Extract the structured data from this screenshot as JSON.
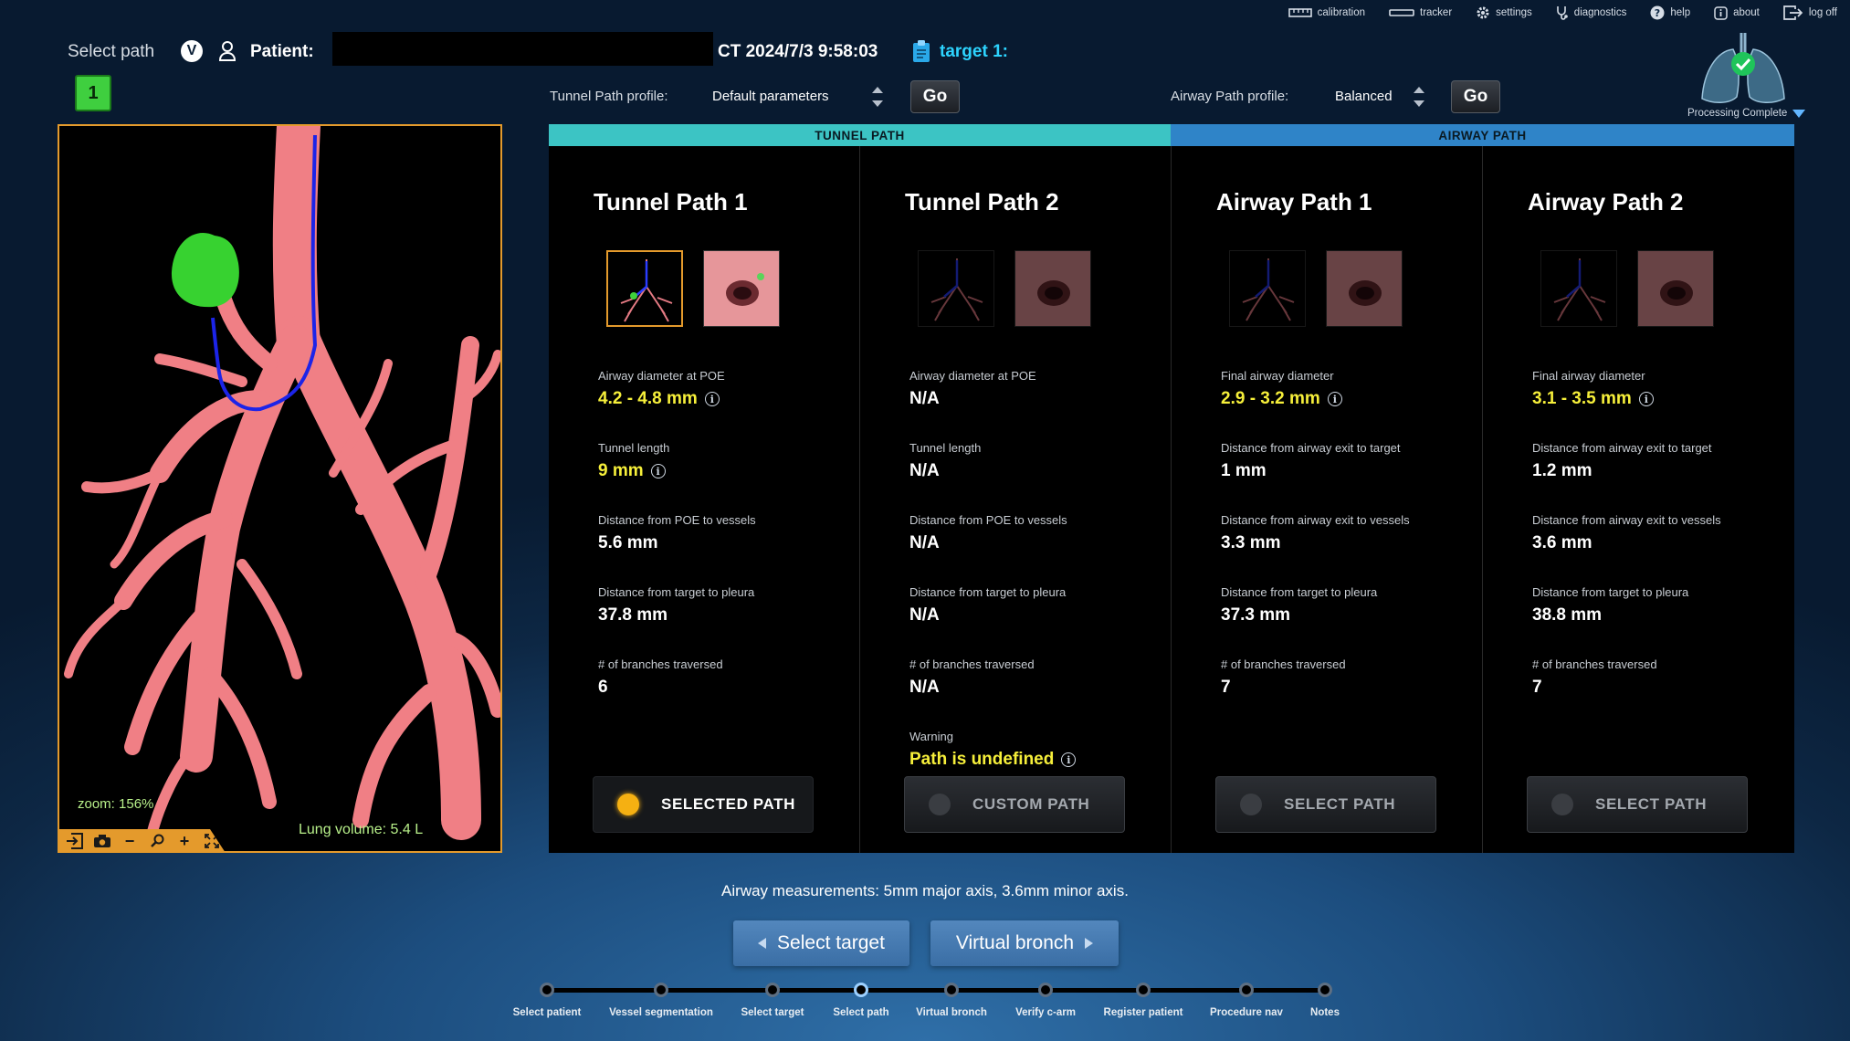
{
  "top_bar": {
    "items": [
      {
        "label": "calibration",
        "icon": "ruler-icon"
      },
      {
        "label": "tracker",
        "icon": "tracker-icon"
      },
      {
        "label": "settings",
        "icon": "gear-icon"
      },
      {
        "label": "diagnostics",
        "icon": "stethoscope-icon"
      },
      {
        "label": "help",
        "icon": "question-icon"
      },
      {
        "label": "about",
        "icon": "info-icon"
      },
      {
        "label": "log off",
        "icon": "logout-icon"
      }
    ]
  },
  "header": {
    "page_label": "Select path",
    "v_badge": "V",
    "patient_label": "Patient:",
    "ct": "CT 2024/7/3 9:58:03",
    "target": "target 1:",
    "path_number": "1"
  },
  "tunnel_profile": {
    "label": "Tunnel Path profile:",
    "value": "Default parameters",
    "go": "Go"
  },
  "airway_profile": {
    "label": "Airway Path profile:",
    "value": "Balanced",
    "go": "Go"
  },
  "lung_status": "Processing Complete",
  "view3d": {
    "zoom": "zoom: 156%",
    "lung_volume": "Lung volume: 5.4 L"
  },
  "groups": {
    "tunnel": "TUNNEL PATH",
    "airway": "AIRWAY PATH"
  },
  "colors": {
    "tunnel_header": "#3cc4c4",
    "airway_header": "#2f84c8",
    "accent_orange": "#e49a2c",
    "value_yellow": "#f6ef3a"
  },
  "paths": [
    {
      "title": "Tunnel Path 1",
      "metrics": [
        {
          "label": "Airway diameter at POE",
          "value": "4.2 - 4.8 mm"
        },
        {
          "label": "Tunnel length",
          "value": "9 mm"
        },
        {
          "label": "Distance from POE to vessels",
          "value": "5.6 mm"
        },
        {
          "label": "Distance from target to pleura",
          "value": "37.8 mm"
        },
        {
          "label": "# of branches traversed",
          "value": "6"
        }
      ],
      "button": "SELECTED PATH"
    },
    {
      "title": "Tunnel Path 2",
      "metrics": [
        {
          "label": "Airway diameter at POE",
          "value": "N/A"
        },
        {
          "label": "Tunnel length",
          "value": "N/A"
        },
        {
          "label": "Distance from POE to vessels",
          "value": "N/A"
        },
        {
          "label": "Distance from target to pleura",
          "value": "N/A"
        },
        {
          "label": "# of branches traversed",
          "value": "N/A"
        }
      ],
      "warning_label": "Warning",
      "warning": "Path is undefined",
      "button": "CUSTOM PATH"
    },
    {
      "title": "Airway Path 1",
      "metrics": [
        {
          "label": "Final airway diameter",
          "value": "2.9 - 3.2 mm"
        },
        {
          "label": "Distance from airway exit to target",
          "value": "1 mm"
        },
        {
          "label": "Distance from airway exit to vessels",
          "value": "3.3 mm"
        },
        {
          "label": "Distance from target to pleura",
          "value": "37.3 mm"
        },
        {
          "label": "# of branches traversed",
          "value": "7"
        }
      ],
      "button": "SELECT PATH"
    },
    {
      "title": "Airway Path 2",
      "metrics": [
        {
          "label": "Final airway diameter",
          "value": "3.1 - 3.5 mm"
        },
        {
          "label": "Distance from airway exit to target",
          "value": "1.2 mm"
        },
        {
          "label": "Distance from airway exit to vessels",
          "value": "3.6 mm"
        },
        {
          "label": "Distance from target to pleura",
          "value": "38.8 mm"
        },
        {
          "label": "# of branches traversed",
          "value": "7"
        }
      ],
      "button": "SELECT PATH"
    }
  ],
  "measurements": "Airway measurements: 5mm major axis, 3.6mm minor axis.",
  "nav": {
    "back": "Select target",
    "next": "Virtual bronch"
  },
  "workflow": [
    "Select patient",
    "Vessel segmentation",
    "Select target",
    "Select path",
    "Virtual bronch",
    "Verify c-arm",
    "Register patient",
    "Procedure nav",
    "Notes"
  ],
  "current_step": "Select path"
}
